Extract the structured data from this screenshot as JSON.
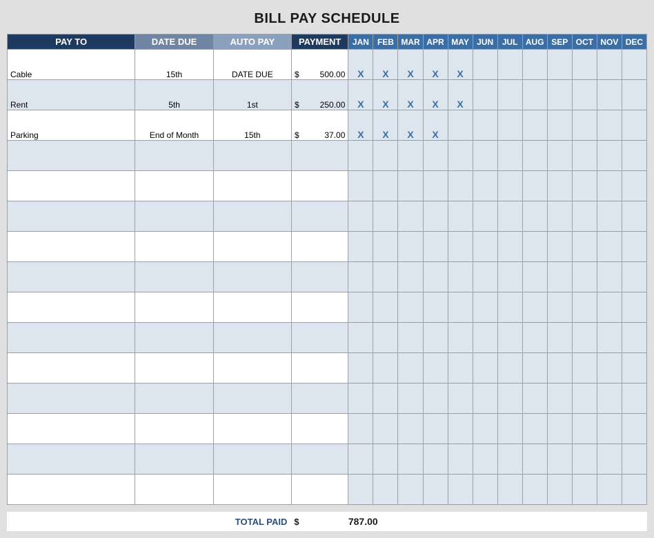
{
  "title": "BILL PAY SCHEDULE",
  "headers": {
    "payto": "PAY TO",
    "datedue": "DATE DUE",
    "autopay": "AUTO PAY",
    "payment": "PAYMENT",
    "months": [
      "JAN",
      "FEB",
      "MAR",
      "APR",
      "MAY",
      "JUN",
      "JUL",
      "AUG",
      "SEP",
      "OCT",
      "NOV",
      "DEC"
    ]
  },
  "currency": "$",
  "rows": [
    {
      "payto": "Cable",
      "datedue": "15th",
      "autopay": "DATE DUE",
      "payment": "500.00",
      "marks": [
        "X",
        "X",
        "X",
        "X",
        "X",
        "",
        "",
        "",
        "",
        "",
        "",
        ""
      ]
    },
    {
      "payto": "Rent",
      "datedue": "5th",
      "autopay": "1st",
      "payment": "250.00",
      "marks": [
        "X",
        "X",
        "X",
        "X",
        "X",
        "",
        "",
        "",
        "",
        "",
        "",
        ""
      ]
    },
    {
      "payto": "Parking",
      "datedue": "End of Month",
      "autopay": "15th",
      "payment": "37.00",
      "marks": [
        "X",
        "X",
        "X",
        "X",
        "",
        "",
        "",
        "",
        "",
        "",
        "",
        ""
      ]
    },
    {
      "payto": "",
      "datedue": "",
      "autopay": "",
      "payment": "",
      "marks": [
        "",
        "",
        "",
        "",
        "",
        "",
        "",
        "",
        "",
        "",
        "",
        ""
      ]
    },
    {
      "payto": "",
      "datedue": "",
      "autopay": "",
      "payment": "",
      "marks": [
        "",
        "",
        "",
        "",
        "",
        "",
        "",
        "",
        "",
        "",
        "",
        ""
      ]
    },
    {
      "payto": "",
      "datedue": "",
      "autopay": "",
      "payment": "",
      "marks": [
        "",
        "",
        "",
        "",
        "",
        "",
        "",
        "",
        "",
        "",
        "",
        ""
      ]
    },
    {
      "payto": "",
      "datedue": "",
      "autopay": "",
      "payment": "",
      "marks": [
        "",
        "",
        "",
        "",
        "",
        "",
        "",
        "",
        "",
        "",
        "",
        ""
      ]
    },
    {
      "payto": "",
      "datedue": "",
      "autopay": "",
      "payment": "",
      "marks": [
        "",
        "",
        "",
        "",
        "",
        "",
        "",
        "",
        "",
        "",
        "",
        ""
      ]
    },
    {
      "payto": "",
      "datedue": "",
      "autopay": "",
      "payment": "",
      "marks": [
        "",
        "",
        "",
        "",
        "",
        "",
        "",
        "",
        "",
        "",
        "",
        ""
      ]
    },
    {
      "payto": "",
      "datedue": "",
      "autopay": "",
      "payment": "",
      "marks": [
        "",
        "",
        "",
        "",
        "",
        "",
        "",
        "",
        "",
        "",
        "",
        ""
      ]
    },
    {
      "payto": "",
      "datedue": "",
      "autopay": "",
      "payment": "",
      "marks": [
        "",
        "",
        "",
        "",
        "",
        "",
        "",
        "",
        "",
        "",
        "",
        ""
      ]
    },
    {
      "payto": "",
      "datedue": "",
      "autopay": "",
      "payment": "",
      "marks": [
        "",
        "",
        "",
        "",
        "",
        "",
        "",
        "",
        "",
        "",
        "",
        ""
      ]
    },
    {
      "payto": "",
      "datedue": "",
      "autopay": "",
      "payment": "",
      "marks": [
        "",
        "",
        "",
        "",
        "",
        "",
        "",
        "",
        "",
        "",
        "",
        ""
      ]
    },
    {
      "payto": "",
      "datedue": "",
      "autopay": "",
      "payment": "",
      "marks": [
        "",
        "",
        "",
        "",
        "",
        "",
        "",
        "",
        "",
        "",
        "",
        ""
      ]
    },
    {
      "payto": "",
      "datedue": "",
      "autopay": "",
      "payment": "",
      "marks": [
        "",
        "",
        "",
        "",
        "",
        "",
        "",
        "",
        "",
        "",
        "",
        ""
      ]
    }
  ],
  "footer": {
    "label": "TOTAL PAID",
    "currency": "$",
    "amount": "787.00"
  }
}
